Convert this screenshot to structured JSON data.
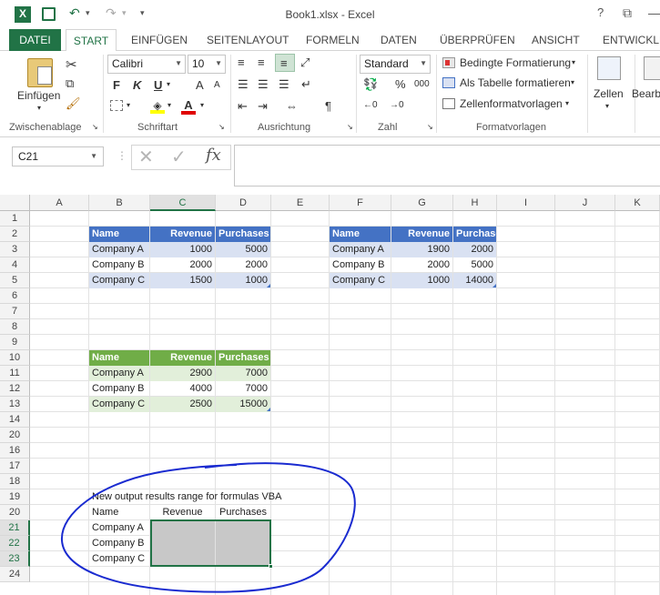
{
  "window": {
    "title": "Book1.xlsx - Excel",
    "help": "?",
    "restore_glyph": "⧉",
    "minimize_glyph": "—",
    "undo_glyph": "↶",
    "redo_glyph": "↷",
    "qa_dropdown": "▾",
    "app_icon_letter": "X"
  },
  "tabs": {
    "file": "DATEI",
    "start": "START",
    "insert": "EINFÜGEN",
    "page_layout": "SEITENLAYOUT",
    "formulas": "FORMELN",
    "data": "DATEN",
    "review": "ÜBERPRÜFEN",
    "view": "ANSICHT",
    "developer": "ENTWICKLE"
  },
  "ribbon": {
    "clipboard": {
      "paste": "Einfügen",
      "label": "Zwischenablage"
    },
    "font": {
      "name": "Calibri",
      "size": "10",
      "bold": "F",
      "italic": "K",
      "underline": "U",
      "grow": "A",
      "shrink": "A",
      "label": "Schriftart"
    },
    "alignment": {
      "label": "Ausrichtung"
    },
    "number": {
      "format": "Standard",
      "percent": "%",
      "thousands": "000",
      "label": "Zahl"
    },
    "styles": {
      "conditional": "Bedingte Formatierung",
      "as_table": "Als Tabelle formatieren",
      "cell_styles": "Zellenformatvorlagen",
      "label": "Formatvorlagen"
    },
    "cells": {
      "label": "Zellen"
    },
    "editing": {
      "label": "Bearbe"
    }
  },
  "formula_bar": {
    "name_box": "C21",
    "formula": "",
    "fx": "fx",
    "cancel": "✕",
    "enter": "✓",
    "dots": "⋮"
  },
  "grid": {
    "columns": [
      "A",
      "B",
      "C",
      "D",
      "E",
      "F",
      "G",
      "H",
      "I",
      "J",
      "K"
    ],
    "rows": [
      "1",
      "2",
      "3",
      "4",
      "5",
      "6",
      "7",
      "8",
      "9",
      "10",
      "11",
      "12",
      "13",
      "14",
      "20",
      "16",
      "17",
      "18",
      "19",
      "20",
      "21",
      "22",
      "23",
      "24"
    ],
    "table1": {
      "headers": [
        "Name",
        "Revenue",
        "Purchases"
      ],
      "rows": [
        [
          "Company A",
          "1000",
          "5000"
        ],
        [
          "Company B",
          "2000",
          "2000"
        ],
        [
          "Company C",
          "1500",
          "1000"
        ]
      ]
    },
    "table2": {
      "headers": [
        "Name",
        "Revenue",
        "Purchases"
      ],
      "rows": [
        [
          "Company A",
          "1900",
          "2000"
        ],
        [
          "Company B",
          "2000",
          "5000"
        ],
        [
          "Company C",
          "1000",
          "14000"
        ]
      ]
    },
    "table3": {
      "headers": [
        "Name",
        "Revenue",
        "Purchases"
      ],
      "rows": [
        [
          "Company A",
          "2900",
          "7000"
        ],
        [
          "Company B",
          "4000",
          "7000"
        ],
        [
          "Company C",
          "2500",
          "15000"
        ]
      ]
    },
    "output": {
      "caption": "New output results range for formulas VBA",
      "headers": [
        "Name",
        "Revenue",
        "Purchases"
      ],
      "names": [
        "Company A",
        "Company B",
        "Company C"
      ]
    }
  },
  "colors": {
    "excel_green": "#217346",
    "table_blue": "#4472c4",
    "band_blue": "#d9e1f2",
    "table_green": "#70ad47",
    "band_green": "#e2efda",
    "ink_circle": "#1a2bd0"
  }
}
